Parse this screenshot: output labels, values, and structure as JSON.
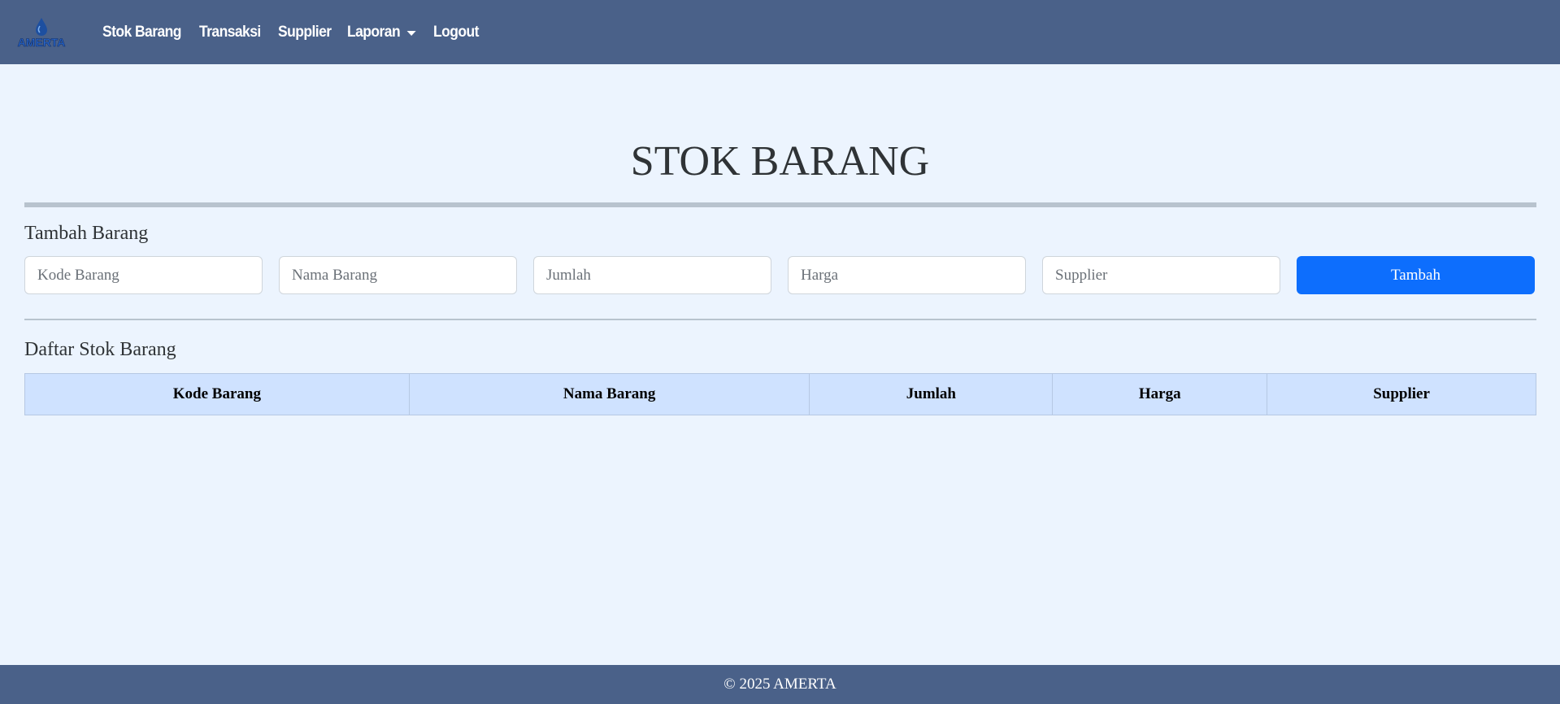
{
  "navbar": {
    "logo_text": "AMERTA",
    "links": [
      {
        "label": "Stok Barang"
      },
      {
        "label": "Transaksi"
      },
      {
        "label": "Supplier"
      },
      {
        "label": "Laporan"
      },
      {
        "label": "Logout"
      }
    ]
  },
  "main": {
    "title": "STOK BARANG",
    "add_section": {
      "heading": "Tambah Barang",
      "fields": {
        "kode": {
          "placeholder": "Kode Barang",
          "value": ""
        },
        "nama": {
          "placeholder": "Nama Barang",
          "value": ""
        },
        "jumlah": {
          "placeholder": "Jumlah",
          "value": ""
        },
        "harga": {
          "placeholder": "Harga",
          "value": ""
        },
        "supplier": {
          "placeholder": "Supplier",
          "value": ""
        }
      },
      "submit_label": "Tambah"
    },
    "list_section": {
      "heading": "Daftar Stok Barang",
      "columns": [
        "Kode Barang",
        "Nama Barang",
        "Jumlah",
        "Harga",
        "Supplier"
      ],
      "rows": []
    }
  },
  "footer": {
    "text": "© 2025 AMERTA"
  },
  "colors": {
    "navbar_bg": "#4a6189",
    "page_bg": "#ecf4fe",
    "primary_button": "#0d6efd",
    "table_header_bg": "#cfe2ff"
  },
  "icons": {
    "logo": "water-drop-logo-icon",
    "dropdown": "caret-down-icon"
  }
}
